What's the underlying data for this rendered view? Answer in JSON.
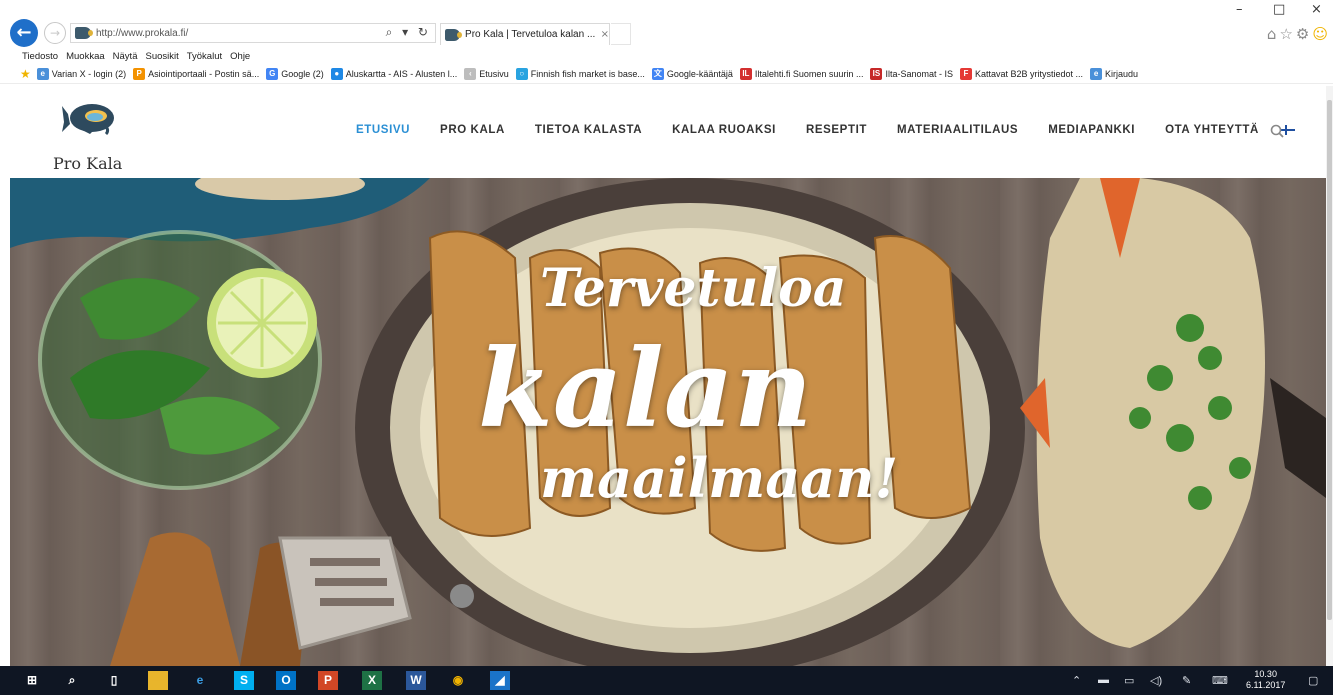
{
  "browser": {
    "address": "http://www.prokala.fi/",
    "tab_title": "Pro Kala | Tervetuloa kalan ...",
    "tab_close": "×",
    "address_tools": "⌕ ▾ ↻",
    "window_minimize": "–",
    "window_maximize": "□",
    "window_close": "×",
    "menu": [
      "Tiedosto",
      "Muokkaa",
      "Näytä",
      "Suosikit",
      "Työkalut",
      "Ohje"
    ],
    "favorites": [
      {
        "label": "Varian X - login (2)",
        "icon_color": "#4a90d9",
        "glyph": "e"
      },
      {
        "label": "Asiointiportaali - Postin sä...",
        "icon_color": "#f39200",
        "glyph": "P"
      },
      {
        "label": "Google (2)",
        "icon_color": "#4285f4",
        "glyph": "G"
      },
      {
        "label": "Aluskartta - AIS - Alusten l...",
        "icon_color": "#1e88e5",
        "glyph": "●"
      },
      {
        "label": "Etusivu",
        "icon_color": "#bdbdbd",
        "glyph": "‹"
      },
      {
        "label": "Finnish fish market is base...",
        "icon_color": "#29a3e0",
        "glyph": "○"
      },
      {
        "label": "Google-kääntäjä",
        "icon_color": "#4285f4",
        "glyph": "文"
      },
      {
        "label": "Iltalehti.fi Suomen suurin ...",
        "icon_color": "#d32f2f",
        "glyph": "IL"
      },
      {
        "label": "Ilta-Sanomat - IS",
        "icon_color": "#c62828",
        "glyph": "IS"
      },
      {
        "label": "Kattavat B2B yritystiedot ...",
        "icon_color": "#e53935",
        "glyph": "F"
      },
      {
        "label": "Kirjaudu",
        "icon_color": "#4a90d9",
        "glyph": "e"
      }
    ]
  },
  "site": {
    "logo_text": "Pro Kala",
    "nav": [
      {
        "label": "ETUSIVU",
        "active": true
      },
      {
        "label": "PRO KALA",
        "active": false
      },
      {
        "label": "TIETOA KALASTA",
        "active": false
      },
      {
        "label": "KALAA RUOAKSI",
        "active": false
      },
      {
        "label": "RESEPTIT",
        "active": false
      },
      {
        "label": "MATERIAALITILAUS",
        "active": false
      },
      {
        "label": "MEDIAPANKKI",
        "active": false
      },
      {
        "label": "OTA YHTEYTTÄ",
        "active": false
      }
    ],
    "hero": {
      "line1": "Tervetuloa",
      "line2": "kalan",
      "line3": "maailmaan!"
    }
  },
  "taskbar": {
    "apps": [
      "start-icon",
      "search-icon",
      "task-view-icon",
      "file-explorer-icon",
      "edge-icon",
      "skype-icon",
      "outlook-icon",
      "powerpoint-icon",
      "excel-icon",
      "word-icon",
      "chrome-icon",
      "app-icon"
    ],
    "time": "10.30",
    "date": "6.11.2017"
  }
}
